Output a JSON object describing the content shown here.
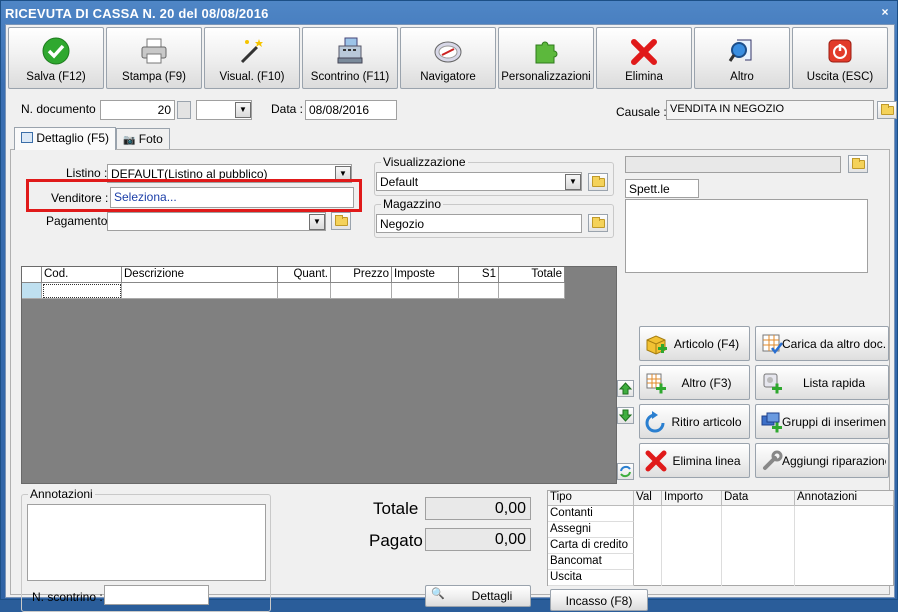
{
  "window": {
    "title": "RICEVUTA DI CASSA N. 20 del 08/08/2016",
    "close": "×"
  },
  "toolbar": [
    {
      "label": "Salva (F12)",
      "icon": "check-icon"
    },
    {
      "label": "Stampa (F9)",
      "icon": "printer-icon"
    },
    {
      "label": "Visual. (F10)",
      "icon": "magic-wand-icon"
    },
    {
      "label": "Scontrino (F11)",
      "icon": "cash-register-icon"
    },
    {
      "label": "Navigatore",
      "icon": "compass-icon"
    },
    {
      "label": "Personalizzazioni",
      "icon": "puzzle-icon"
    },
    {
      "label": "Elimina",
      "icon": "delete-x-icon"
    },
    {
      "label": "Altro",
      "icon": "search-doc-icon"
    },
    {
      "label": "Uscita (ESC)",
      "icon": "power-icon"
    }
  ],
  "header": {
    "ndoc_label": "N. documento :",
    "ndoc_value": "20",
    "data_label": "Data :",
    "data_value": "08/08/2016",
    "causale_label": "Causale :",
    "causale_value": "VENDITA IN NEGOZIO"
  },
  "tabs": [
    {
      "label": "Dettaglio (F5)"
    },
    {
      "label": "Foto"
    }
  ],
  "form": {
    "listino_label": "Listino :",
    "listino_value": "DEFAULT(Listino al pubblico)",
    "venditore_label": "Venditore :",
    "venditore_value": "Seleziona...",
    "pagamento_label": "Pagamento :",
    "pagamento_value": "",
    "visualizzazione_label": "Visualizzazione",
    "visualizzazione_value": "Default",
    "magazzino_label": "Magazzino",
    "magazzino_value": "Negozio",
    "cliente_value": "",
    "spett_value": "Spett.le"
  },
  "grid": {
    "columns": [
      "Cod.",
      "Descrizione",
      "Quant.",
      "Prezzo",
      "Imposte",
      "S1",
      "Totale"
    ]
  },
  "actions": [
    {
      "label": "Articolo (F4)",
      "icon": "add-article-icon"
    },
    {
      "label": "Carica da altro doc.",
      "icon": "load-doc-icon"
    },
    {
      "label": "Altro (F3)",
      "icon": "add-other-icon"
    },
    {
      "label": "Lista rapida",
      "icon": "quick-list-icon"
    },
    {
      "label": "Ritiro articolo",
      "icon": "return-icon"
    },
    {
      "label": "Gruppi di inserimento",
      "icon": "groups-icon"
    },
    {
      "label": "Elimina linea",
      "icon": "delete-line-icon"
    },
    {
      "label": "Aggiungi riparazione",
      "icon": "wrench-icon"
    }
  ],
  "annotazioni": {
    "label": "Annotazioni",
    "scontrino_label": "N. scontrino :",
    "scontrino_value": ""
  },
  "totals": {
    "totale_label": "Totale",
    "totale_value": "0,00",
    "pagato_label": "Pagato",
    "pagato_value": "0,00",
    "dettagli_label": "Dettagli"
  },
  "payments": {
    "columns": [
      "Tipo",
      "Val",
      "Importo",
      "Data",
      "Annotazioni"
    ],
    "rows": [
      "Contanti",
      "Assegni",
      "Carta di credito",
      "Bancomat",
      "Uscita"
    ],
    "incasso_label": "Incasso (F8)"
  },
  "colors": {
    "accent": "#e01a1a",
    "title_bar": "#2f63a5"
  }
}
